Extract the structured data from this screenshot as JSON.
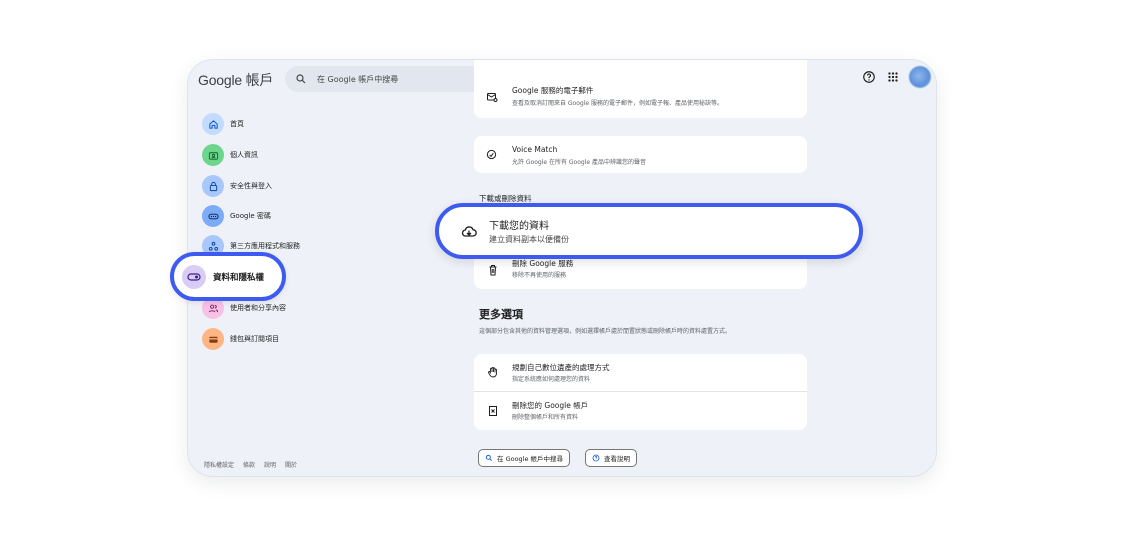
{
  "header": {
    "logo_text": "Google 帳戶",
    "search_placeholder": "在 Google 帳戶中搜尋"
  },
  "sidebar": {
    "items": [
      {
        "label": "首頁",
        "icon": "home-icon",
        "color": "#c2dbff"
      },
      {
        "label": "個人資訊",
        "icon": "id-card-icon",
        "color": "#6dd58c"
      },
      {
        "label": "安全性與登入",
        "icon": "lock-icon",
        "color": "#a8c7fa"
      },
      {
        "label": "Google 密碼",
        "icon": "password-icon",
        "color": "#7cacf8"
      },
      {
        "label": "第三方應用程式和服務",
        "icon": "connected-apps-icon",
        "color": "#a8c7fa"
      },
      {
        "label": "資料和隱私權",
        "icon": "toggle-icon",
        "color": "#d9ccf7"
      },
      {
        "label": "使用者和分享內容",
        "icon": "people-icon",
        "color": "#f8c1e6"
      },
      {
        "label": "錢包與訂閱項目",
        "icon": "wallet-icon",
        "color": "#ffb684"
      }
    ],
    "footer": [
      "隱私權設定",
      "條款",
      "說明",
      "關於"
    ]
  },
  "main": {
    "email_row": {
      "title": "Google 服務的電子郵件",
      "subtitle": "查看及取消訂閱來自 Google 服務的電子郵件，例如電子報、產品使用秘訣等。"
    },
    "voice_match": {
      "title": "Voice Match",
      "subtitle": "允許 Google 在所有 Google 產品中辨識您的聲音"
    },
    "download_section_label": "下載或刪除資料",
    "download": {
      "title": "下載您的資料",
      "subtitle": "建立資料副本以便備份"
    },
    "delete_service": {
      "title": "刪除 Google 服務",
      "subtitle": "移除不再使用的服務"
    },
    "more_options": {
      "title": "更多選項",
      "description": "這個部分包含其他的資料管理選項，例如選擇帳戶處於閒置狀態或刪除帳戶時的資料處置方式。"
    },
    "legacy": {
      "title": "規劃自己數位遺產的處理方式",
      "subtitle": "指定系統應如何處理您的資料"
    },
    "delete_account": {
      "title": "刪除您的 Google 帳戶",
      "subtitle": "刪除整個帳戶和所有資料"
    },
    "search_chip": "在 Google 帳戶中搜尋",
    "help_chip": "查看說明"
  },
  "colors": {
    "highlight": "#3d5bf0",
    "page_bg": "#eef2f8"
  }
}
